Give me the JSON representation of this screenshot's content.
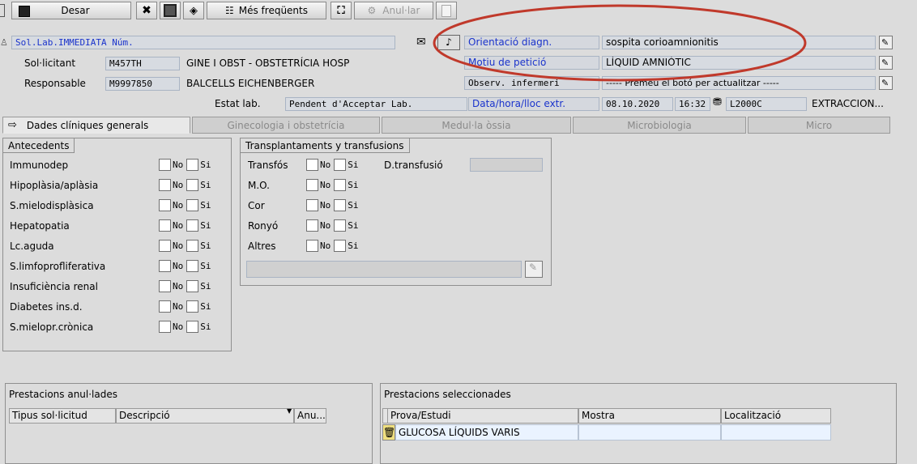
{
  "toolbar": {
    "desar": "Desar",
    "mes_frequents": "Més freqüents",
    "anullar": "Anul·lar"
  },
  "header": {
    "request_title": "Sol.Lab.IMMEDIATA Núm.",
    "sollicitant_label": "Sol·licitant",
    "sollicitant_code": "M457TH",
    "sollicitant_name": "GINE I OBST - OBSTETRÍCIA HOSP",
    "responsable_label": "Responsable",
    "responsable_code": "M9997850",
    "responsable_name": "BALCELLS EICHENBERGER",
    "estat_label": "Estat lab.",
    "estat_value": "Pendent d'Acceptar Lab."
  },
  "right_fields": {
    "orientacio_label": "Orientació diagn.",
    "orientacio_value": "sospita corioamnionitis",
    "motiu_label": "Motiu de petició",
    "motiu_value": "LÍQUID AMNIÒTIC",
    "observ_label": "Observ. infermeri",
    "observ_value": "----- Premeu el botó per actualitzar -----",
    "data_label": "Data/hora/lloc extr.",
    "date_value": "08.10.2020",
    "time_value": "16:32",
    "lloc_code": "L2000C",
    "lloc_name": "EXTRACCION..."
  },
  "tabs": [
    {
      "label": "Dades clíniques generals"
    },
    {
      "label": "Ginecologia i obstetrícia"
    },
    {
      "label": "Medul·la òssia"
    },
    {
      "label": "Microbiologia"
    },
    {
      "label": "Micro"
    }
  ],
  "antecedents": {
    "title": "Antecedents",
    "no": "No",
    "si": "Si",
    "items": [
      "Immunodep",
      "Hipoplàsia/aplàsia",
      "S.mielodisplàsica",
      "Hepatopatia",
      "Lc.aguda",
      "S.limfoprofliferativa",
      "Insuficiència renal",
      "Diabetes ins.d.",
      "S.mielopr.crònica"
    ]
  },
  "transplants": {
    "title": "Transplantaments y transfusions",
    "no": "No",
    "si": "Si",
    "items": [
      "Transfós",
      "M.O.",
      "Cor",
      "Ronyó",
      "Altres"
    ],
    "transfusio_label": "D.transfusió"
  },
  "anulades": {
    "title": "Prestacions anul·lades",
    "columns": [
      "Tipus sol·licitud",
      "Descripció",
      "Anu..."
    ]
  },
  "seleccionades": {
    "title": "Prestacions seleccionades",
    "columns": [
      "Prova/Estudi",
      "Mostra",
      "Localització"
    ],
    "rows": [
      {
        "prova": "GLUCOSA LÍQUIDS VARIS",
        "mostra": "",
        "localitzacio": ""
      }
    ]
  },
  "colors": {
    "annotation": "#c0392b",
    "link_blue": "#1a33cc",
    "table_cell": "#eaf3ff"
  }
}
